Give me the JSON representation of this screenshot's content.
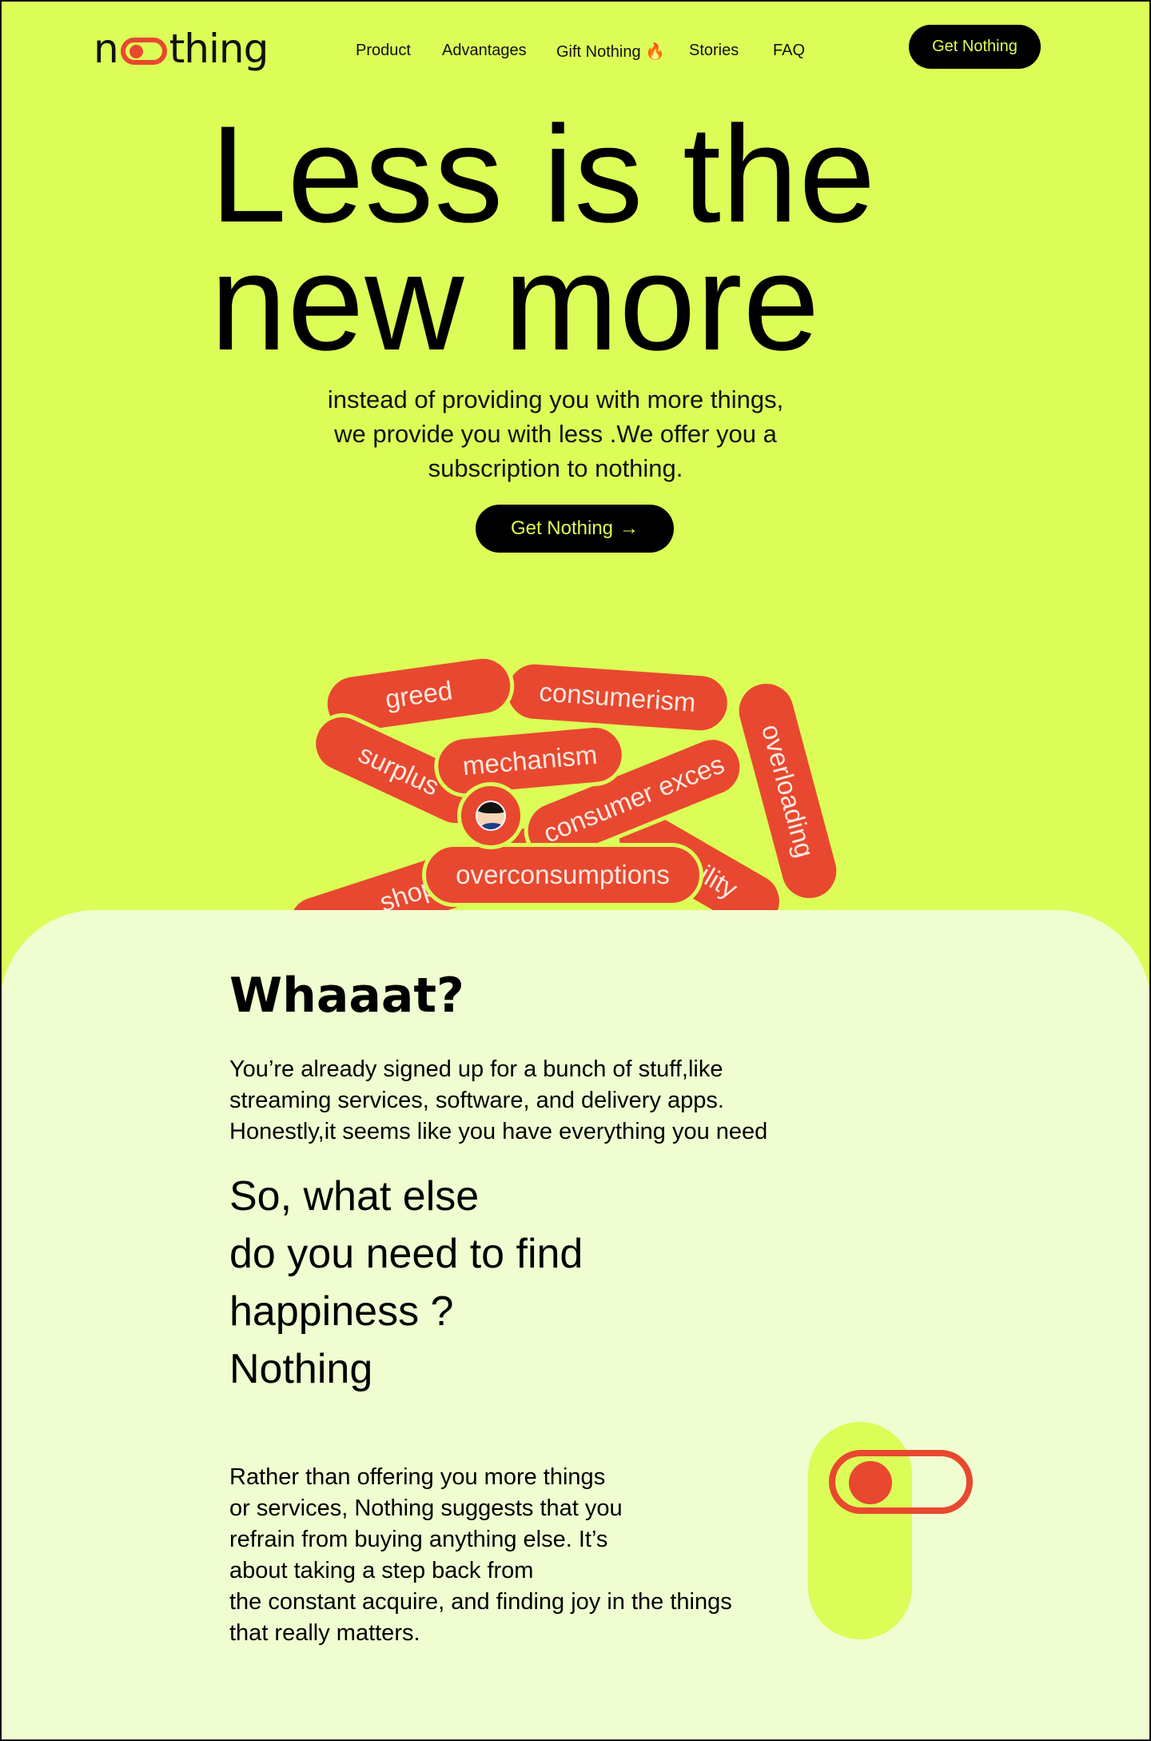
{
  "nav": {
    "logo_pre": "n",
    "logo_post": "thing",
    "items": [
      "Product",
      "Advantages",
      "Gift Nothing",
      "Stories",
      "FAQ"
    ],
    "gift_flame": "🔥",
    "cta": "Get Nothing"
  },
  "hero": {
    "title_line1": "Less is the",
    "title_line2": "new more",
    "subtitle_line1": "instead of providing you with more things,",
    "subtitle_line2": "we provide you with less .We offer you a",
    "subtitle_line3": "subscription to nothing.",
    "cta": "Get Nothing",
    "cta_arrow": "→"
  },
  "pills": {
    "greed": "greed",
    "consumerism": "consumerism",
    "overloading": "overloading",
    "surplus": "surplus",
    "mechanism": "mechanism",
    "consumer_excess": "consumer exces",
    "shopping": "shopping",
    "overconsumptions": "overconsumptions",
    "capability": "pability"
  },
  "about": {
    "heading": "Whaaat?",
    "para1_line1": "You’re already signed up for a bunch of stuff,like",
    "para1_line2": "streaming services, software, and delivery apps.",
    "para1_line3": "Honestly,it seems like you have everything you need",
    "question_line1": "So, what else",
    "question_line2": "do you need to find",
    "question_line3": "happiness ?",
    "question_line4": "Nothing",
    "para2_line1": "Rather than offering you more things",
    "para2_line2": "or services, Nothing suggests that you",
    "para2_line3": "refrain from buying anything else. It’s",
    "para2_line4": "about taking a step back from",
    "para2_line5": "the constant acquire, and finding joy in the things",
    "para2_line6": "that really matters."
  },
  "colors": {
    "lime": "#dcfd57",
    "cream": "#f0fdd1",
    "red": "#e8482f",
    "black": "#000000"
  }
}
